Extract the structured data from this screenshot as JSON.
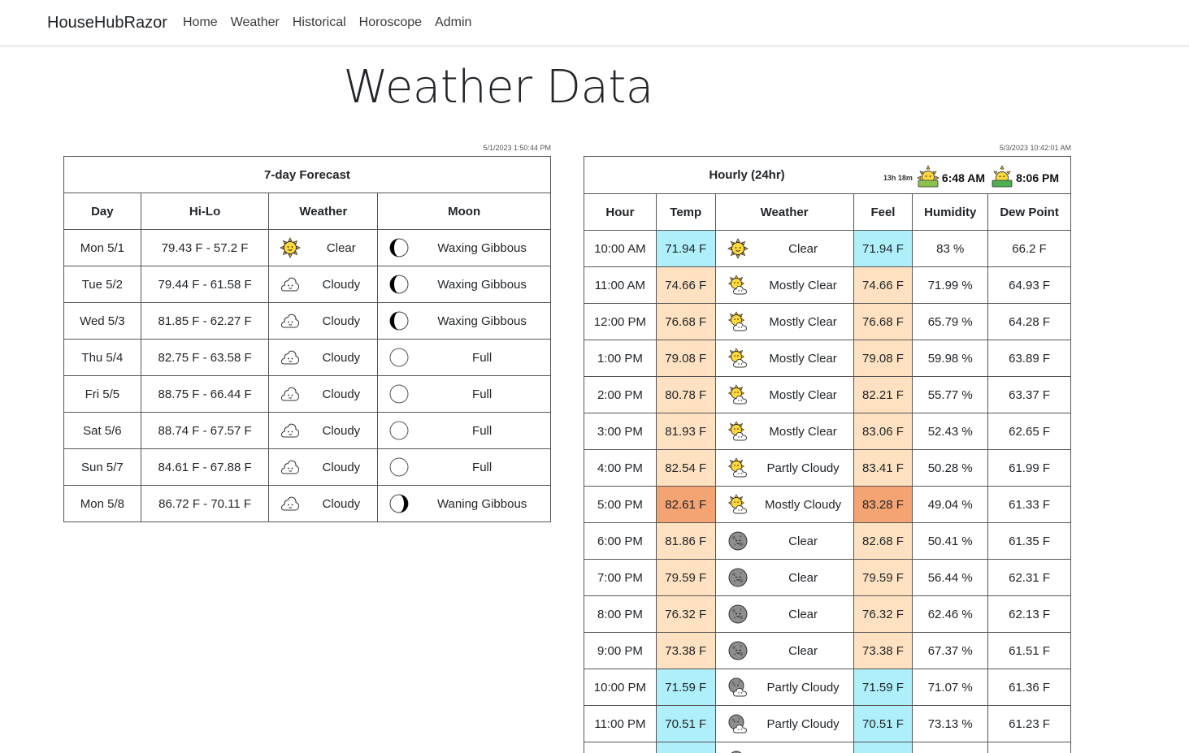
{
  "nav": {
    "brand": "HouseHubRazor",
    "links": [
      "Home",
      "Weather",
      "Historical",
      "Horoscope",
      "Admin"
    ]
  },
  "page": {
    "title": "Weather Data"
  },
  "forecast": {
    "timestamp": "5/1/2023 1:50:44 PM",
    "title": "7-day Forecast",
    "headers": [
      "Day",
      "Hi-Lo",
      "Weather",
      "Moon"
    ],
    "rows": [
      {
        "day": "Mon 5/1",
        "hilo": "79.43 F - 57.2 F",
        "weather": "Clear",
        "weather_icon": "sun-face-icon",
        "moon": "Waxing Gibbous",
        "moon_icon": "moon-waxing-gibbous-icon"
      },
      {
        "day": "Tue 5/2",
        "hilo": "79.44 F - 61.58 F",
        "weather": "Cloudy",
        "weather_icon": "cloud-icon",
        "moon": "Waxing Gibbous",
        "moon_icon": "moon-waxing-gibbous-icon"
      },
      {
        "day": "Wed 5/3",
        "hilo": "81.85 F - 62.27 F",
        "weather": "Cloudy",
        "weather_icon": "cloud-icon",
        "moon": "Waxing Gibbous",
        "moon_icon": "moon-waxing-gibbous-icon"
      },
      {
        "day": "Thu 5/4",
        "hilo": "82.75 F - 63.58 F",
        "weather": "Cloudy",
        "weather_icon": "cloud-icon",
        "moon": "Full",
        "moon_icon": "moon-full-icon"
      },
      {
        "day": "Fri 5/5",
        "hilo": "88.75 F - 66.44 F",
        "weather": "Cloudy",
        "weather_icon": "cloud-icon",
        "moon": "Full",
        "moon_icon": "moon-full-icon"
      },
      {
        "day": "Sat 5/6",
        "hilo": "88.74 F - 67.57 F",
        "weather": "Cloudy",
        "weather_icon": "cloud-icon",
        "moon": "Full",
        "moon_icon": "moon-full-icon"
      },
      {
        "day": "Sun 5/7",
        "hilo": "84.61 F - 67.88 F",
        "weather": "Cloudy",
        "weather_icon": "cloud-icon",
        "moon": "Full",
        "moon_icon": "moon-full-icon"
      },
      {
        "day": "Mon 5/8",
        "hilo": "86.72 F - 70.11 F",
        "weather": "Cloudy",
        "weather_icon": "cloud-icon",
        "moon": "Waning Gibbous",
        "moon_icon": "moon-waning-gibbous-icon"
      }
    ]
  },
  "hourly": {
    "timestamp": "5/3/2023 10:42:01 AM",
    "title": "Hourly (24hr)",
    "daylight": "13h 18m",
    "sunrise": "6:48 AM",
    "sunset": "8:06 PM",
    "headers": [
      "Hour",
      "Temp",
      "Weather",
      "Feel",
      "Humidity",
      "Dew Point"
    ],
    "colors": {
      "cold": "#aeeffa",
      "warm": "#fde1c0",
      "hot": "#f4a373"
    },
    "rows": [
      {
        "hour": "10:00 AM",
        "temp": "71.94 F",
        "temp_level": "cold",
        "weather": "Clear",
        "weather_icon": "sun-face-icon",
        "feel": "71.94 F",
        "feel_level": "cold",
        "humidity": "83 %",
        "dew": "66.2 F"
      },
      {
        "hour": "11:00 AM",
        "temp": "74.66 F",
        "temp_level": "warm",
        "weather": "Mostly Clear",
        "weather_icon": "sun-cloud-icon",
        "feel": "74.66 F",
        "feel_level": "warm",
        "humidity": "71.99 %",
        "dew": "64.93 F"
      },
      {
        "hour": "12:00 PM",
        "temp": "76.68 F",
        "temp_level": "warm",
        "weather": "Mostly Clear",
        "weather_icon": "sun-cloud-icon",
        "feel": "76.68 F",
        "feel_level": "warm",
        "humidity": "65.79 %",
        "dew": "64.28 F"
      },
      {
        "hour": "1:00 PM",
        "temp": "79.08 F",
        "temp_level": "warm",
        "weather": "Mostly Clear",
        "weather_icon": "sun-cloud-icon",
        "feel": "79.08 F",
        "feel_level": "warm",
        "humidity": "59.98 %",
        "dew": "63.89 F"
      },
      {
        "hour": "2:00 PM",
        "temp": "80.78 F",
        "temp_level": "warm",
        "weather": "Mostly Clear",
        "weather_icon": "sun-cloud-icon",
        "feel": "82.21 F",
        "feel_level": "warm",
        "humidity": "55.77 %",
        "dew": "63.37 F"
      },
      {
        "hour": "3:00 PM",
        "temp": "81.93 F",
        "temp_level": "warm",
        "weather": "Mostly Clear",
        "weather_icon": "sun-cloud-icon",
        "feel": "83.06 F",
        "feel_level": "warm",
        "humidity": "52.43 %",
        "dew": "62.65 F"
      },
      {
        "hour": "4:00 PM",
        "temp": "82.54 F",
        "temp_level": "warm",
        "weather": "Partly Cloudy",
        "weather_icon": "sun-cloud-icon",
        "feel": "83.41 F",
        "feel_level": "warm",
        "humidity": "50.28 %",
        "dew": "61.99 F"
      },
      {
        "hour": "5:00 PM",
        "temp": "82.61 F",
        "temp_level": "hot",
        "weather": "Mostly Cloudy",
        "weather_icon": "sun-cloud-icon",
        "feel": "83.28 F",
        "feel_level": "hot",
        "humidity": "49.04 %",
        "dew": "61.33 F"
      },
      {
        "hour": "6:00 PM",
        "temp": "81.86 F",
        "temp_level": "warm",
        "weather": "Clear",
        "weather_icon": "moon-face-icon",
        "feel": "82.68 F",
        "feel_level": "warm",
        "humidity": "50.41 %",
        "dew": "61.35 F"
      },
      {
        "hour": "7:00 PM",
        "temp": "79.59 F",
        "temp_level": "warm",
        "weather": "Clear",
        "weather_icon": "moon-face-icon",
        "feel": "79.59 F",
        "feel_level": "warm",
        "humidity": "56.44 %",
        "dew": "62.31 F"
      },
      {
        "hour": "8:00 PM",
        "temp": "76.32 F",
        "temp_level": "warm",
        "weather": "Clear",
        "weather_icon": "moon-face-icon",
        "feel": "76.32 F",
        "feel_level": "warm",
        "humidity": "62.46 %",
        "dew": "62.13 F"
      },
      {
        "hour": "9:00 PM",
        "temp": "73.38 F",
        "temp_level": "warm",
        "weather": "Clear",
        "weather_icon": "moon-face-icon",
        "feel": "73.38 F",
        "feel_level": "warm",
        "humidity": "67.37 %",
        "dew": "61.51 F"
      },
      {
        "hour": "10:00 PM",
        "temp": "71.59 F",
        "temp_level": "cold",
        "weather": "Partly Cloudy",
        "weather_icon": "moon-cloud-icon",
        "feel": "71.59 F",
        "feel_level": "cold",
        "humidity": "71.07 %",
        "dew": "61.36 F"
      },
      {
        "hour": "11:00 PM",
        "temp": "70.51 F",
        "temp_level": "cold",
        "weather": "Partly Cloudy",
        "weather_icon": "moon-cloud-icon",
        "feel": "70.51 F",
        "feel_level": "cold",
        "humidity": "73.13 %",
        "dew": "61.23 F"
      },
      {
        "hour": "",
        "temp": "",
        "temp_level": "cold",
        "weather": "",
        "weather_icon": "moon-cloud-icon",
        "feel": "",
        "feel_level": "cold",
        "humidity": "",
        "dew": ""
      }
    ]
  }
}
